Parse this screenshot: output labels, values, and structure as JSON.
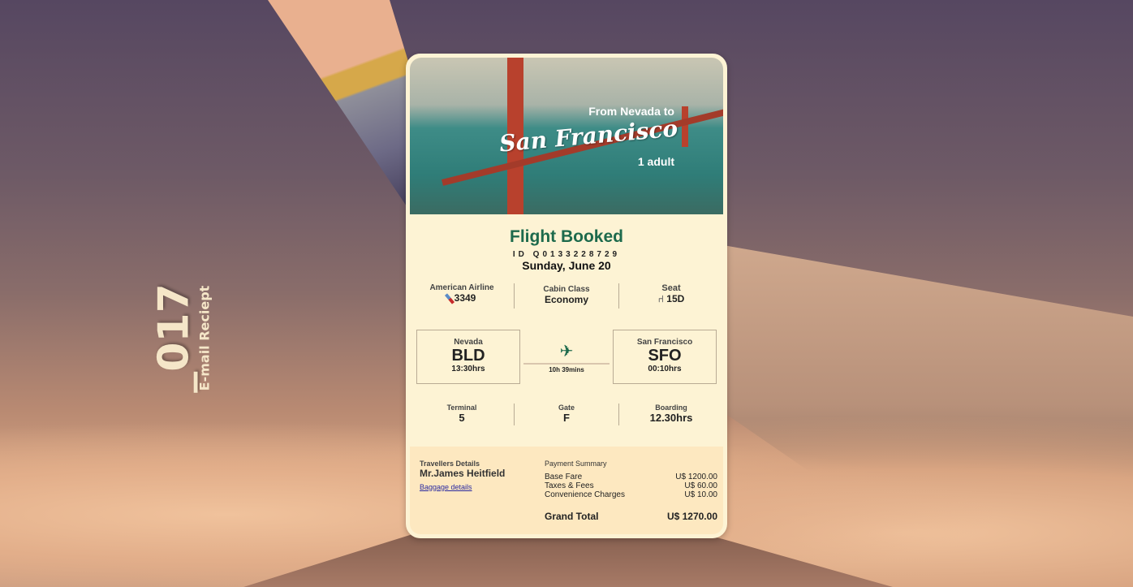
{
  "side": {
    "number": "_017",
    "label": "E-mail Reciept"
  },
  "hero": {
    "from": "From Nevada to",
    "to": "San Francisco",
    "passengers": "1 adult"
  },
  "booking": {
    "title": "Flight Booked",
    "id": "ID Q0133228729",
    "date": "Sunday, June 20"
  },
  "info": {
    "airline_label": "American Airline",
    "flight_number": "3349",
    "cabin_label": "Cabin Class",
    "cabin_value": "Economy",
    "seat_label": "Seat",
    "seat_value": "15D"
  },
  "route": {
    "origin_city": "Nevada",
    "origin_code": "BLD",
    "origin_time": "13:30hrs",
    "duration": "10h 39mins",
    "dest_city": "San Francisco",
    "dest_code": "SFO",
    "dest_time": "00:10hrs"
  },
  "gate": {
    "terminal_label": "Terminal",
    "terminal_value": "5",
    "gate_label": "Gate",
    "gate_value": "F",
    "boarding_label": "Boarding",
    "boarding_value": "12.30hrs"
  },
  "travellers": {
    "label": "Travellers Details",
    "name": "Mr.James Heitfield",
    "baggage_link": "Baggage details"
  },
  "payment": {
    "label": "Payment Summary",
    "items": [
      {
        "name": "Base Fare",
        "amount": "U$ 1200.00"
      },
      {
        "name": "Taxes & Fees",
        "amount": "U$ 60.00"
      },
      {
        "name": "Convenience Charges",
        "amount": "U$ 10.00"
      }
    ],
    "total_label": "Grand Total",
    "total_amount": "U$ 1270.00"
  },
  "colors": {
    "accent": "#1d6a4c",
    "card": "#fdf3d4",
    "summary": "#fde8c0"
  }
}
